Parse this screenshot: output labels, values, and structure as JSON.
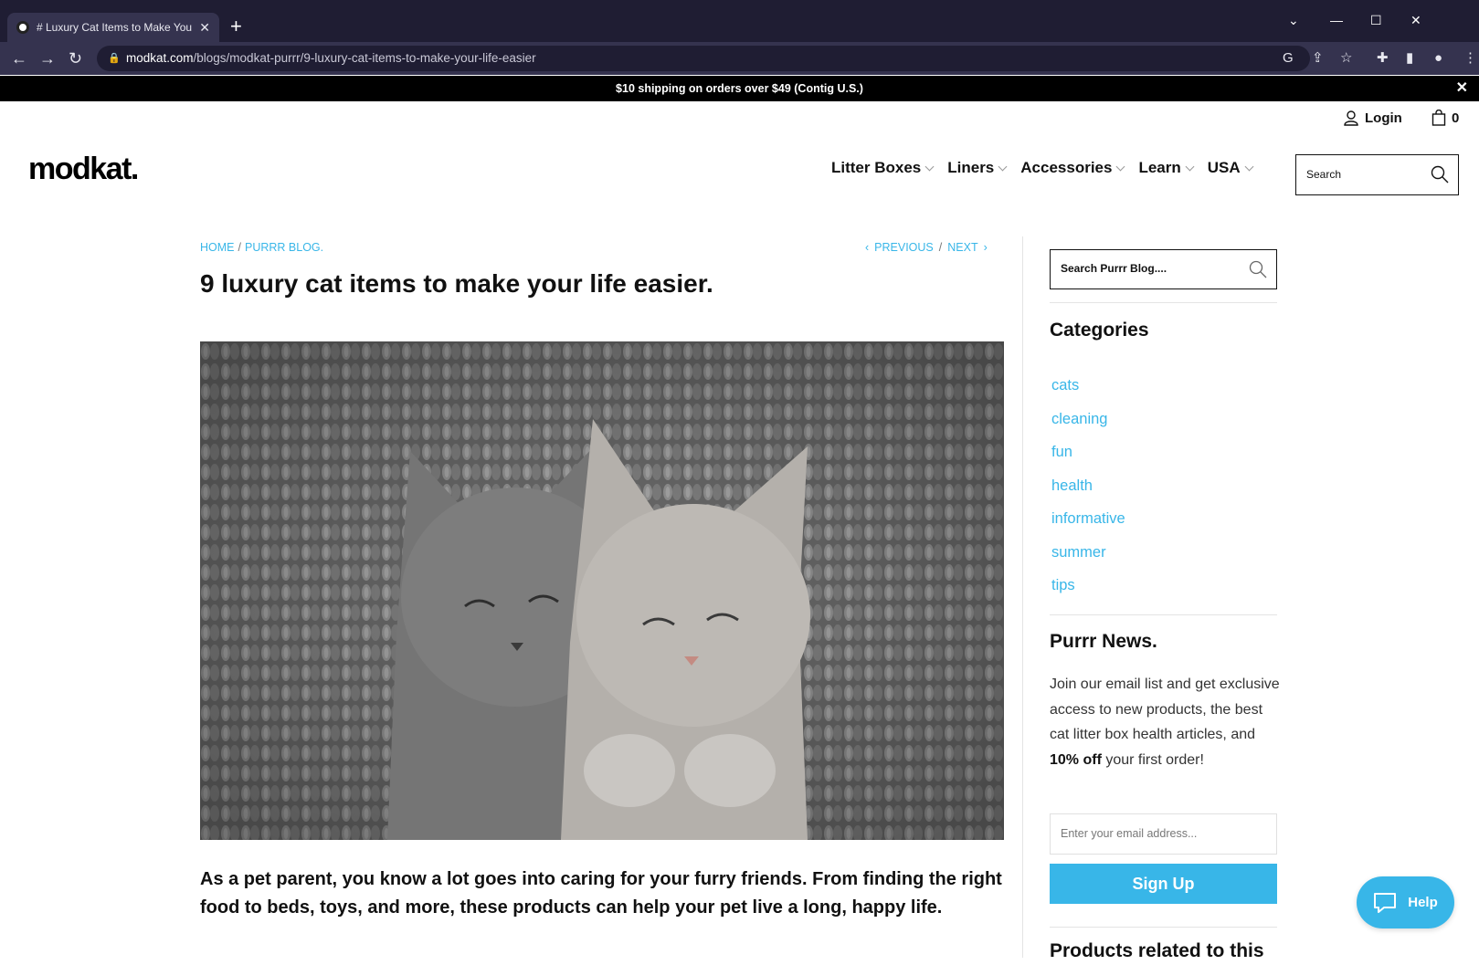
{
  "browser": {
    "tab_title": "# Luxury Cat Items to Make Your",
    "url_host": "modkat.com",
    "url_path": "/blogs/modkat-purrr/9-luxury-cat-items-to-make-your-life-easier"
  },
  "announcement": {
    "text": "$10 shipping on orders over $49 (Contig U.S.)"
  },
  "header": {
    "logo": "modkat.",
    "login_label": "Login",
    "cart_count": "0",
    "nav": [
      "Litter Boxes",
      "Liners",
      "Accessories",
      "Learn",
      "USA"
    ],
    "search_placeholder": "Search"
  },
  "article": {
    "breadcrumb": [
      "HOME",
      "PURRR BLOG."
    ],
    "prev_label": "PREVIOUS",
    "next_label": "NEXT",
    "title": "9 luxury cat items to make your life easier.",
    "lead": "As a pet parent, you know a lot goes into caring for your furry friends. From finding the right food to beds, toys, and more, these products can help your pet live a long, happy life."
  },
  "sidebar": {
    "search_placeholder": "Search Purrr Blog....",
    "categories_heading": "Categories",
    "categories": [
      "cats",
      "cleaning",
      "fun",
      "health",
      "informative",
      "summer",
      "tips"
    ],
    "news_heading": "Purrr News.",
    "news_text_1": "Join our email list and get exclusive access to new products, the best cat litter box health articles, and ",
    "news_bold": "10% off",
    "news_text_2": " your first order!",
    "email_placeholder": "Enter your email address...",
    "signup_label": "Sign Up",
    "related_heading": "Products related to this"
  },
  "help_label": "Help",
  "colors": {
    "accent": "#38b6e8",
    "chrome_dark": "#1f1d33",
    "chrome_mid": "#35334f"
  }
}
